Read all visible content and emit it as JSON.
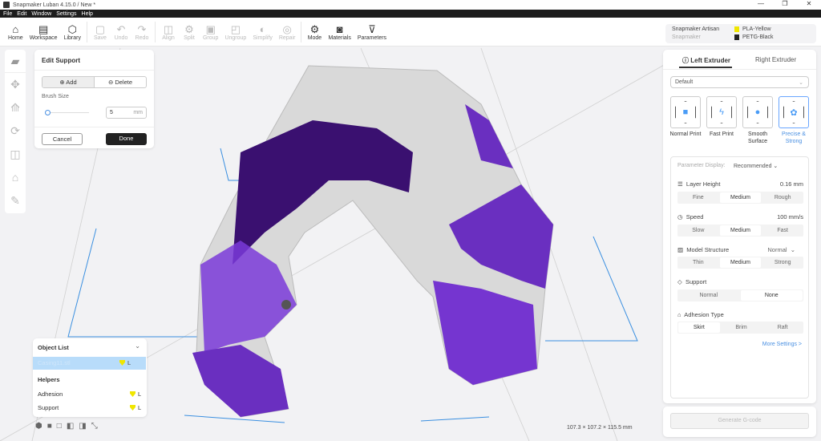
{
  "window": {
    "title": "Snapmaker Luban 4.15.0 / New *",
    "controls": [
      "—",
      "❐",
      "✕"
    ]
  },
  "menu": [
    "File",
    "Edit",
    "Window",
    "Settings",
    "Help"
  ],
  "toolbar": [
    {
      "label": "Home",
      "icon": "⌂",
      "enabled": true
    },
    {
      "label": "Workspace",
      "icon": "▤",
      "enabled": true
    },
    {
      "label": "Library",
      "icon": "⬡",
      "enabled": true
    },
    {
      "label": "Save",
      "icon": "▢",
      "enabled": false
    },
    {
      "label": "Undo",
      "icon": "↶",
      "enabled": false
    },
    {
      "label": "Redo",
      "icon": "↷",
      "enabled": false
    },
    {
      "label": "Align",
      "icon": "◫",
      "enabled": false
    },
    {
      "label": "Split",
      "icon": "⚙",
      "enabled": false
    },
    {
      "label": "Group",
      "icon": "▣",
      "enabled": false
    },
    {
      "label": "Ungroup",
      "icon": "◰",
      "enabled": false
    },
    {
      "label": "Simplify",
      "icon": "◐",
      "enabled": false
    },
    {
      "label": "Repair",
      "icon": "◎",
      "enabled": false
    },
    {
      "label": "Mode",
      "icon": "⚙",
      "enabled": true
    },
    {
      "label": "Materials",
      "icon": "◙",
      "enabled": true
    },
    {
      "label": "Parameters",
      "icon": "⊽",
      "enabled": true
    }
  ],
  "machine": {
    "name": "Snapmaker Artisan",
    "brand": "Snapmaker",
    "materials": [
      "PLA-Yellow",
      "PETG-Black"
    ],
    "colors": [
      "#f0e600",
      "#222222"
    ]
  },
  "edit_support": {
    "title": "Edit Support",
    "add": "Add",
    "delete": "Delete",
    "brush_label": "Brush Size",
    "brush_value": "5",
    "brush_unit": "mm",
    "cancel": "Cancel",
    "done": "Done"
  },
  "object_list": {
    "title": "Object List",
    "object": "Casing11.stl",
    "extruder": "L",
    "helpers_title": "Helpers",
    "helpers": [
      {
        "label": "Adhesion",
        "extruder": "L"
      },
      {
        "label": "Support",
        "extruder": "L"
      }
    ]
  },
  "dimensions": "107.3 × 107.2 × 115.5 mm",
  "right_panel": {
    "tabs": [
      "Left Extruder",
      "Right Extruder"
    ],
    "profile": "Default",
    "presets": [
      {
        "label": "Normal Print",
        "icon": "■"
      },
      {
        "label": "Fast Print",
        "icon": "ϟ"
      },
      {
        "label": "Smooth Surface",
        "icon": "●"
      },
      {
        "label": "Precise & Strong",
        "icon": "✿"
      }
    ],
    "param_display_label": "Parameter Display:",
    "param_display_value": "Recommended",
    "layer_height": {
      "label": "Layer Height",
      "value": "0.16 mm",
      "options": [
        "Fine",
        "Medium",
        "Rough"
      ],
      "selected": "Medium"
    },
    "speed": {
      "label": "Speed",
      "value": "100 mm/s",
      "options": [
        "Slow",
        "Medium",
        "Fast"
      ],
      "selected": "Medium"
    },
    "model_structure": {
      "label": "Model Structure",
      "value": "Normal",
      "options": [
        "Thin",
        "Medium",
        "Strong"
      ],
      "selected": "Medium"
    },
    "support": {
      "label": "Support",
      "options": [
        "Normal",
        "None"
      ],
      "selected": "None"
    },
    "adhesion": {
      "label": "Adhesion Type",
      "options": [
        "Skirt",
        "Brim",
        "Raft"
      ],
      "selected": "Skirt"
    },
    "more": "More Settings >",
    "generate": "Generate G-code"
  },
  "colors": {
    "accent": "#4a90e2",
    "purple": "#6a2fc0",
    "dark_purple": "#3a1070",
    "model_grey": "#d8d8d8"
  }
}
